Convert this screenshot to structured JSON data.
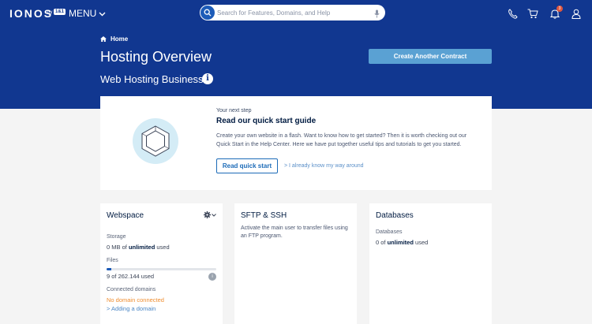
{
  "header": {
    "logo": "IONOS",
    "logo_by": "by",
    "logo_brand": "1&1",
    "menu_label": "MENU",
    "search_placeholder": "Search for Features, Domains, and Help",
    "notification_count": "3"
  },
  "breadcrumb": {
    "home": "Home"
  },
  "page": {
    "title": "Hosting Overview",
    "subtitle": "Web Hosting Business",
    "info_glyph": "i",
    "create_button": "Create Another Contract"
  },
  "quick_start": {
    "eyebrow": "Your next step",
    "title": "Read our quick start guide",
    "text": "Create your own website in a flash. Want to know how to get started? Then it is worth checking out our Quick Start in the Help Center. Here we have put together useful tips and tutorials to get you started.",
    "button": "Read quick start",
    "link": "> I already know my way around"
  },
  "webspace": {
    "title": "Webspace",
    "storage_label": "Storage",
    "storage_prefix": "0 MB of ",
    "storage_bold": "unlimited",
    "storage_suffix": " used",
    "files_label": "Files",
    "files_value": "9 of 262.144 used",
    "files_fraction": 0.04,
    "files_badge": "i",
    "domains_label": "Connected domains",
    "domains_warning": "No domain connected",
    "add_domain": "> Adding a domain"
  },
  "sftp": {
    "title": "SFTP & SSH",
    "text": "Activate the main user to transfer files using an FTP program."
  },
  "databases": {
    "title": "Databases",
    "label": "Databases",
    "value_prefix": "0 of ",
    "value_bold": "unlimited",
    "value_suffix": " used"
  },
  "colors": {
    "brand_blue": "#113790",
    "accent_blue": "#5aa1d3",
    "warning": "#ef8e31"
  },
  "icons": {
    "search": "search-icon",
    "mic": "microphone-icon",
    "phone": "phone-icon",
    "cart": "cart-icon",
    "bell": "bell-icon",
    "user": "user-icon",
    "home": "home-icon",
    "gear": "gear-icon"
  }
}
